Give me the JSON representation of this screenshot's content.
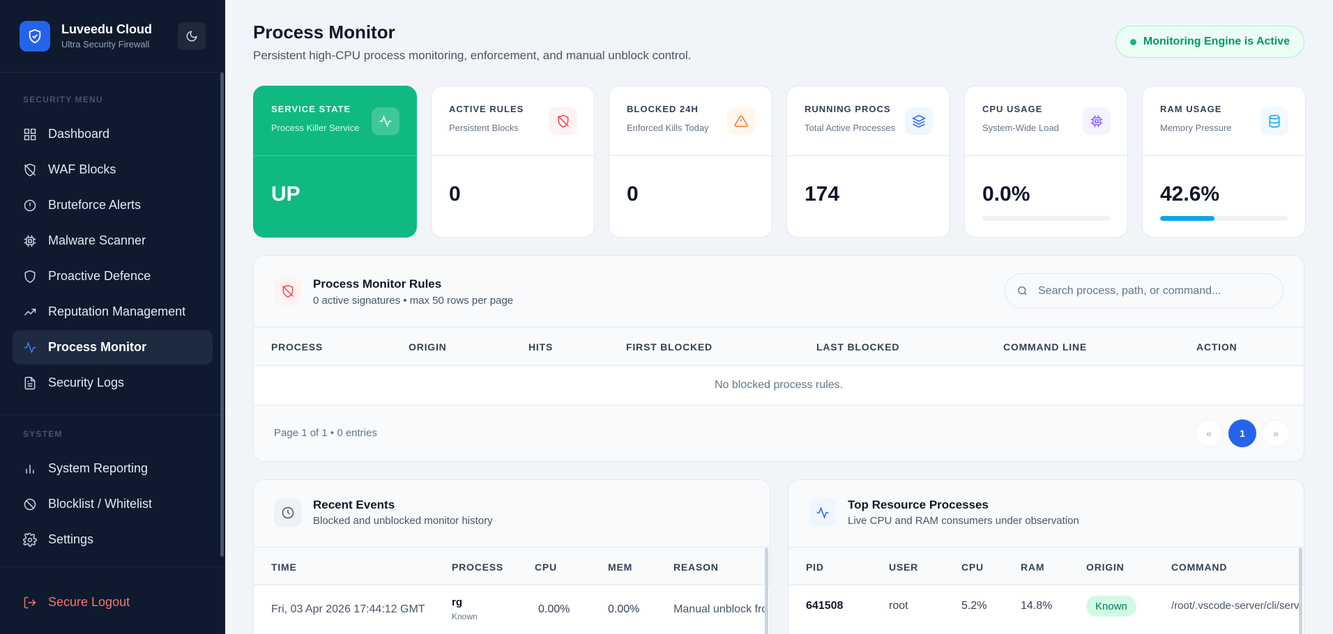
{
  "brand": {
    "name": "Luveedu Cloud",
    "subtitle": "Ultra Security Firewall"
  },
  "sidebar": {
    "section_security": "SECURITY MENU",
    "security_items": [
      {
        "label": "Dashboard",
        "icon": "grid-icon"
      },
      {
        "label": "WAF Blocks",
        "icon": "shield-off-icon"
      },
      {
        "label": "Bruteforce Alerts",
        "icon": "alert-circle-icon"
      },
      {
        "label": "Malware Scanner",
        "icon": "cpu-icon"
      },
      {
        "label": "Proactive Defence",
        "icon": "shield-icon"
      },
      {
        "label": "Reputation Management",
        "icon": "trending-up-icon"
      },
      {
        "label": "Process Monitor",
        "icon": "activity-icon",
        "active": true
      },
      {
        "label": "Security Logs",
        "icon": "file-text-icon"
      }
    ],
    "section_system": "SYSTEM",
    "system_items": [
      {
        "label": "System Reporting",
        "icon": "bar-chart-icon"
      },
      {
        "label": "Blocklist / Whitelist",
        "icon": "ban-icon"
      },
      {
        "label": "Settings",
        "icon": "gear-icon"
      }
    ],
    "logout": "Secure Logout"
  },
  "header": {
    "title": "Process Monitor",
    "subtitle": "Persistent high-CPU process monitoring, enforcement, and manual unblock control.",
    "engine_status": "Monitoring Engine is Active"
  },
  "stats": [
    {
      "label": "SERVICE STATE",
      "sublabel": "Process Killer Service",
      "value": "UP",
      "icon": "activity-icon"
    },
    {
      "label": "ACTIVE RULES",
      "sublabel": "Persistent Blocks",
      "value": "0",
      "icon": "shield-off-icon"
    },
    {
      "label": "BLOCKED 24H",
      "sublabel": "Enforced Kills Today",
      "value": "0",
      "icon": "warning-triangle-icon"
    },
    {
      "label": "RUNNING PROCS",
      "sublabel": "Total Active Processes",
      "value": "174",
      "icon": "layers-icon"
    },
    {
      "label": "CPU USAGE",
      "sublabel": "System-Wide Load",
      "value": "0.0%",
      "icon": "cpu-icon",
      "progress": 0.0
    },
    {
      "label": "RAM USAGE",
      "sublabel": "Memory Pressure",
      "value": "42.6%",
      "icon": "database-icon",
      "progress": 42.6
    }
  ],
  "colors": {
    "accent": "#2563eb",
    "success": "#10b981",
    "sidebar_bg": "#0f1a2e",
    "danger": "#f87171"
  },
  "rules": {
    "title": "Process Monitor Rules",
    "subtitle": "0 active signatures • max 50 rows per page",
    "search_placeholder": "Search process, path, or command...",
    "columns": [
      "PROCESS",
      "ORIGIN",
      "HITS",
      "FIRST BLOCKED",
      "LAST BLOCKED",
      "COMMAND LINE",
      "ACTION"
    ],
    "empty_message": "No blocked process rules.",
    "page_info": "Page 1 of 1 • 0 entries",
    "pager": {
      "prev": "«",
      "current": "1",
      "next": "»"
    }
  },
  "events": {
    "title": "Recent Events",
    "subtitle": "Blocked and unblocked monitor history",
    "columns": [
      "TIME",
      "PROCESS",
      "CPU",
      "MEM",
      "REASON"
    ],
    "rows": [
      {
        "time": "Fri, 03 Apr 2026 17:44:12 GMT",
        "process": "rg",
        "origin": "Known",
        "cpu": "0.00%",
        "mem": "0.00%",
        "reason": "Manual unblock fro"
      }
    ]
  },
  "top": {
    "title": "Top Resource Processes",
    "subtitle": "Live CPU and RAM consumers under observation",
    "columns": [
      "PID",
      "USER",
      "CPU",
      "RAM",
      "ORIGIN",
      "COMMAND"
    ],
    "rows": [
      {
        "pid": "641508",
        "user": "root",
        "cpu": "5.2%",
        "ram": "14.8%",
        "origin": "Known",
        "command": "/root/.vscode-server/cli/serv"
      }
    ]
  }
}
